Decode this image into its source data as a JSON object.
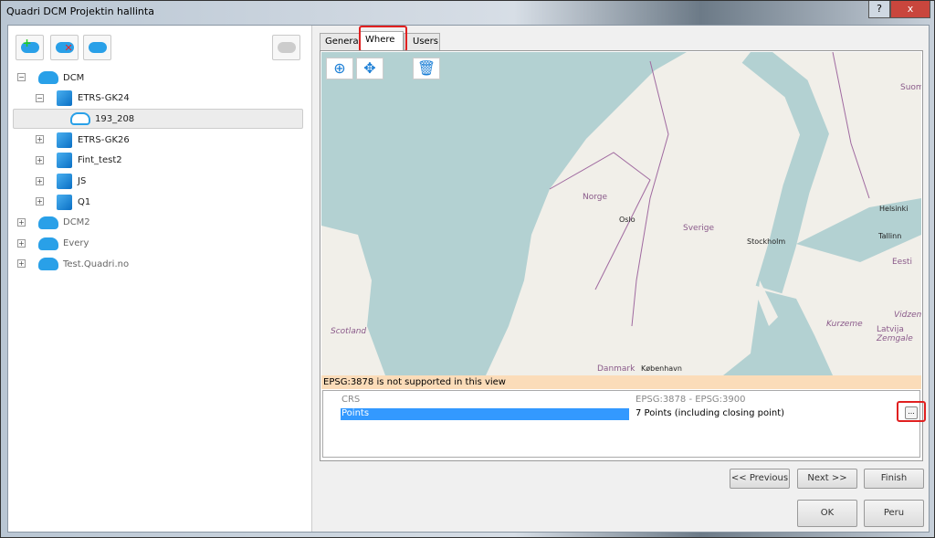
{
  "window": {
    "title": "Quadri DCM Projektin hallinta",
    "help": "?",
    "close": "x"
  },
  "toolbar": {
    "icons": [
      "add-cloud-icon",
      "delete-cloud-icon",
      "search-cloud-icon",
      "disabled-cloud-icon"
    ]
  },
  "tree": [
    {
      "label": "DCM",
      "level": 0,
      "icon": "cloud",
      "expanded": true
    },
    {
      "label": "ETRS-GK24",
      "level": 1,
      "icon": "cube",
      "expanded": true
    },
    {
      "label": "193_208",
      "level": 2,
      "icon": "cloud-outline",
      "selected": true
    },
    {
      "label": "ETRS-GK26",
      "level": 1,
      "icon": "cube"
    },
    {
      "label": "Fint_test2",
      "level": 1,
      "icon": "cube"
    },
    {
      "label": "JS",
      "level": 1,
      "icon": "cube"
    },
    {
      "label": "Q1",
      "level": 1,
      "icon": "cube"
    },
    {
      "label": "DCM2",
      "level": 0,
      "icon": "cloud"
    },
    {
      "label": "Every",
      "level": 0,
      "icon": "cloud"
    },
    {
      "label": "Test.Quadri.no",
      "level": 0,
      "icon": "cloud"
    }
  ],
  "tabs": [
    {
      "label": "General"
    },
    {
      "label": "Where",
      "active": true
    },
    {
      "label": "Users"
    }
  ],
  "map": {
    "labels": {
      "norge": "Norge",
      "oslo": "Oslo",
      "sverige": "Sverige",
      "stockholm": "Stockholm",
      "helsinki": "Helsinki",
      "tallinn": "Tallinn",
      "eesti": "Eesti",
      "suomi": "Suom",
      "scotland": "Scotland",
      "danmark": "Danmark",
      "kobenhavn": "København",
      "kurzeme": "Kurzeme",
      "latvija": "Latvija",
      "zemgale": "Zemgale",
      "vidzeme": "Vidzeme"
    }
  },
  "warning": "EPSG:3878 is not supported in this view",
  "props": [
    {
      "name": "CRS",
      "value": "EPSG:3878 - EPSG:3900"
    },
    {
      "name": "Points",
      "value": "7 Points (including closing point)",
      "selected": true,
      "button": "..."
    }
  ],
  "buttons": {
    "previous": "<< Previous",
    "next": "Next >>",
    "finish": "Finish",
    "ok": "OK",
    "cancel": "Peru"
  },
  "colors": {
    "selection": "#3399ff",
    "warning": "#fbdcb9",
    "highlight": "#e02020"
  }
}
